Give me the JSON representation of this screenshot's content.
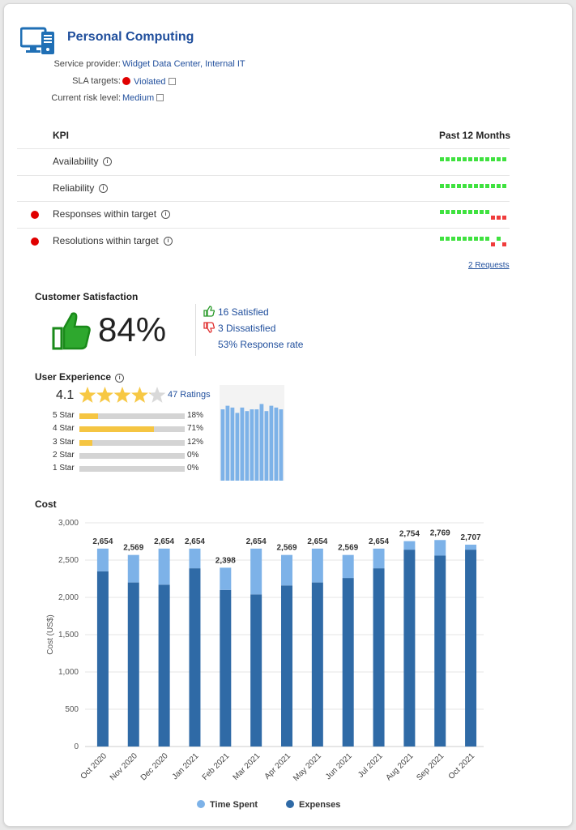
{
  "service": {
    "title": "Personal Computing",
    "provider_label": "Service provider:",
    "provider_value": "Widget Data Center, Internal IT",
    "sla_label": "SLA targets:",
    "sla_value": "Violated",
    "risk_label": "Current risk level:",
    "risk_value": "Medium",
    "icon": "computer-icon"
  },
  "kpi": {
    "header_kpi": "KPI",
    "header_period": "Past 12 Months",
    "rows": [
      {
        "label": "Availability",
        "alert": false,
        "months": [
          "g",
          "g",
          "g",
          "g",
          "g",
          "g",
          "g",
          "g",
          "g",
          "g",
          "g",
          "g"
        ]
      },
      {
        "label": "Reliability",
        "alert": false,
        "months": [
          "g",
          "g",
          "g",
          "g",
          "g",
          "g",
          "g",
          "g",
          "g",
          "g",
          "g",
          "g"
        ]
      },
      {
        "label": "Responses within target",
        "alert": true,
        "months": [
          "g",
          "g",
          "g",
          "g",
          "g",
          "g",
          "g",
          "g",
          "g",
          "r",
          "r",
          "r"
        ]
      },
      {
        "label": "Resolutions within target",
        "alert": true,
        "months": [
          "g",
          "g",
          "g",
          "g",
          "g",
          "g",
          "g",
          "g",
          "g",
          "r",
          "g",
          "r"
        ]
      }
    ],
    "requests_link": "2 Requests"
  },
  "csat": {
    "title": "Customer Satisfaction",
    "percent": "84%",
    "satisfied": "16 Satisfied",
    "dissatisfied": "3 Dissatisfied",
    "response_rate": "53% Response rate"
  },
  "ux": {
    "title": "User Experience",
    "average": "4.1",
    "rating_value": 4.1,
    "ratings_link": "47 Ratings",
    "breakdown": [
      {
        "label": "5 Star",
        "pct": "18%",
        "value": 18
      },
      {
        "label": "4 Star",
        "pct": "71%",
        "value": 71
      },
      {
        "label": "3 Star",
        "pct": "12%",
        "value": 12
      },
      {
        "label": "2 Star",
        "pct": "0%",
        "value": 0
      },
      {
        "label": "1 Star",
        "pct": "0%",
        "value": 0
      }
    ],
    "trend_values": [
      4.0,
      4.2,
      4.1,
      3.8,
      4.1,
      3.9,
      4.0,
      4.0,
      4.3,
      3.9,
      4.2,
      4.1,
      4.0
    ]
  },
  "cost": {
    "title": "Cost",
    "chart_data": {
      "type": "bar",
      "stacked": true,
      "categories": [
        "Oct 2020",
        "Nov 2020",
        "Dec 2020",
        "Jan 2021",
        "Feb 2021",
        "Mar 2021",
        "Apr 2021",
        "May 2021",
        "Jun 2021",
        "Jul 2021",
        "Aug 2021",
        "Sep 2021",
        "Oct 2021"
      ],
      "series": [
        {
          "name": "Expenses",
          "color": "#2f6aa6",
          "values": [
            2350,
            2200,
            2170,
            2390,
            2100,
            2040,
            2160,
            2200,
            2260,
            2390,
            2640,
            2560,
            2640
          ]
        },
        {
          "name": "Time Spent",
          "color": "#7db2e8",
          "values": [
            304,
            369,
            484,
            264,
            298,
            614,
            409,
            454,
            309,
            264,
            114,
            209,
            67
          ]
        }
      ],
      "totals": [
        "2,654",
        "2,569",
        "2,654",
        "2,654",
        "2,398",
        "2,654",
        "2,569",
        "2,654",
        "2,569",
        "2,654",
        "2,754",
        "2,769",
        "2,707"
      ],
      "ylabel": "Cost (US$)",
      "ylim": [
        0,
        3000
      ],
      "yticks": [
        "0",
        "500",
        "1,000",
        "1,500",
        "2,000",
        "2,500",
        "3,000"
      ],
      "legend_position": "bottom",
      "grid": true
    }
  }
}
